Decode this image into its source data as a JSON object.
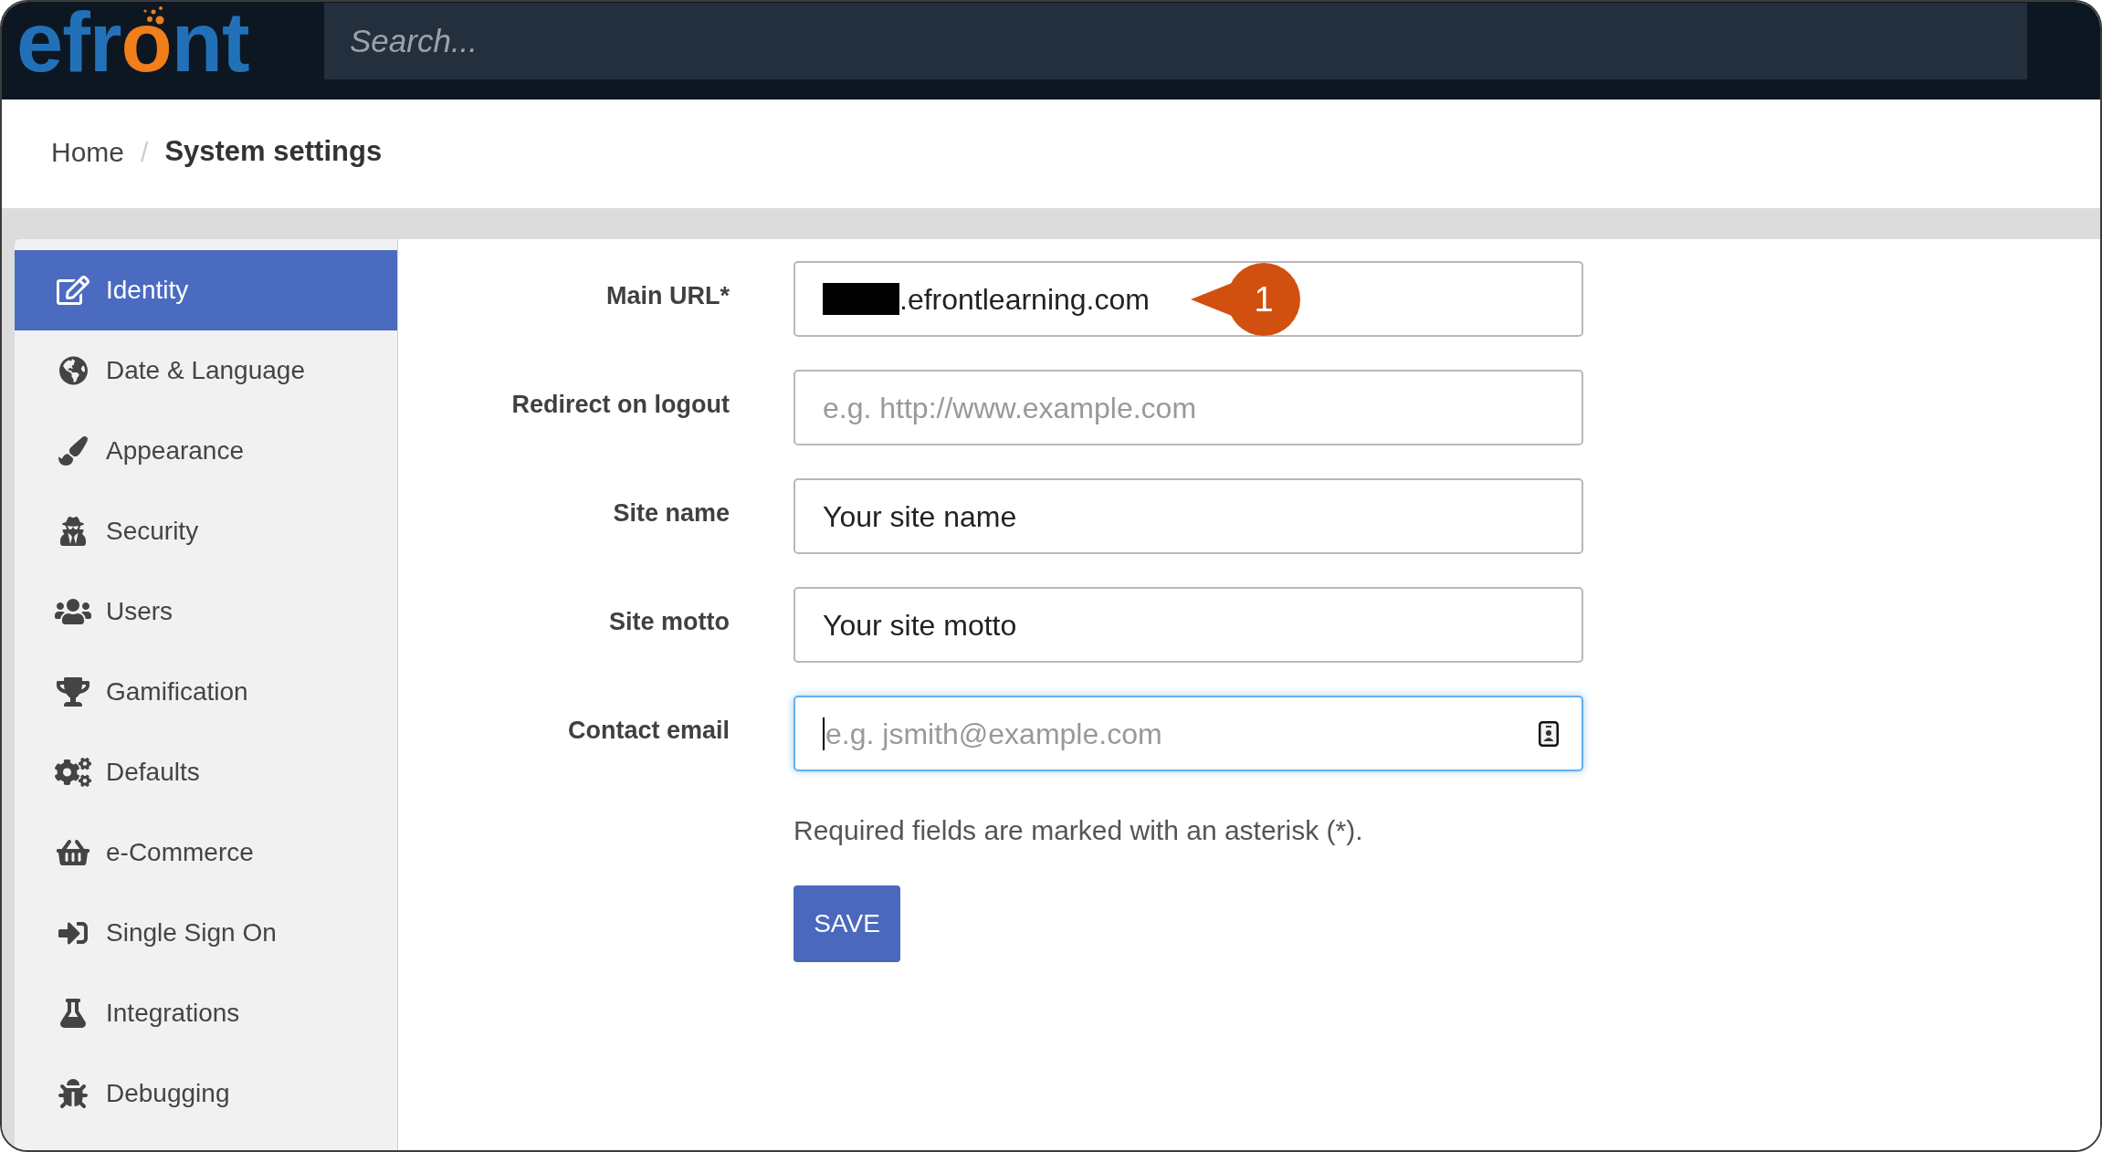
{
  "header": {
    "logo": [
      {
        "text": "efr",
        "color": "#2271b8"
      },
      {
        "text": "o",
        "color": "#ef7e1b"
      },
      {
        "text": "nt",
        "color": "#2271b8"
      }
    ],
    "search": {
      "placeholder": "Search..."
    }
  },
  "breadcrumb": {
    "separator": "/",
    "items": [
      {
        "label": "Home",
        "current": false
      },
      {
        "label": "System settings",
        "current": true
      }
    ]
  },
  "sidebar": {
    "items": [
      {
        "label": "Identity",
        "selected": true
      },
      {
        "label": "Date & Language",
        "selected": false
      },
      {
        "label": "Appearance",
        "selected": false
      },
      {
        "label": "Security",
        "selected": false
      },
      {
        "label": "Users",
        "selected": false
      },
      {
        "label": "Gamification",
        "selected": false
      },
      {
        "label": "Defaults",
        "selected": false
      },
      {
        "label": "e-Commerce",
        "selected": false
      },
      {
        "label": "Single Sign On",
        "selected": false
      },
      {
        "label": "Integrations",
        "selected": false
      },
      {
        "label": "Debugging",
        "selected": false
      }
    ]
  },
  "form": {
    "fields": [
      {
        "label": "Main URL*",
        "value": ".efrontlearning.com",
        "redacted": true,
        "focused": false,
        "autofill_icon": false,
        "callout": "1"
      },
      {
        "label": "Redirect on logout",
        "placeholder": "e.g. http://www.example.com",
        "redacted": false,
        "focused": false,
        "autofill_icon": false
      },
      {
        "label": "Site name",
        "value": "Your site name",
        "redacted": false,
        "focused": false,
        "autofill_icon": false
      },
      {
        "label": "Site motto",
        "value": "Your site motto",
        "redacted": false,
        "focused": false,
        "autofill_icon": false
      },
      {
        "label": "Contact email",
        "placeholder": "e.g. jsmith@example.com",
        "redacted": false,
        "focused": true,
        "autofill_icon": true
      }
    ],
    "note": "Required fields are marked with an asterisk (*).",
    "save_button": {
      "label": "SAVE"
    }
  }
}
